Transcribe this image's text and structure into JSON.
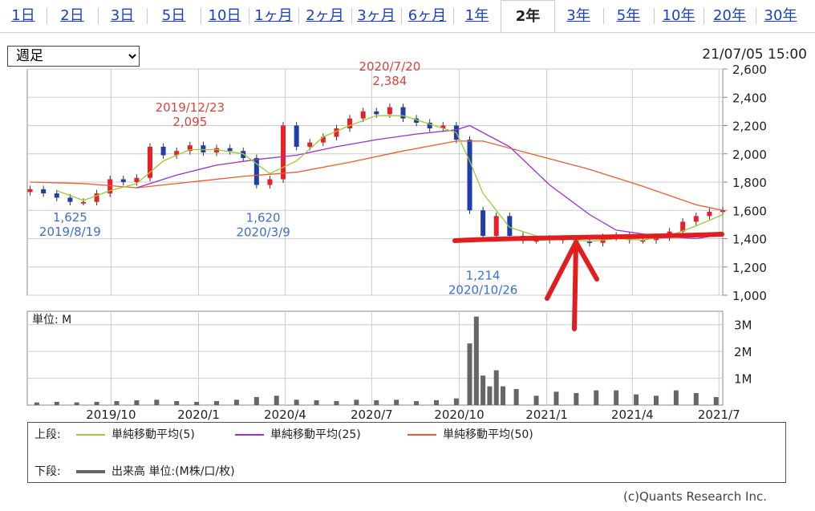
{
  "tabs": [
    "1日",
    "2日",
    "3日",
    "5日",
    "10日",
    "1ヶ月",
    "2ヶ月",
    "3ヶ月",
    "6ヶ月",
    "1年",
    "2年",
    "3年",
    "5年",
    "10年",
    "20年",
    "30年"
  ],
  "active_tab": "2年",
  "period_select": {
    "value": "週足",
    "options": [
      "週足"
    ]
  },
  "timestamp": "21/07/05 15:00",
  "colors": {
    "up": "#e8202a",
    "down": "#1f3ea8",
    "ma5": "#9acd32",
    "ma25": "#9b30d9",
    "ma50": "#ef5b2a",
    "volume": "#666666",
    "annot_high": "#d9443c",
    "annot_low": "#3a6fd8",
    "markup": "#e11d1d"
  },
  "legend": {
    "upper_label": "上段:",
    "lower_label": "下段:",
    "ma5": "単純移動平均(5)",
    "ma25": "単純移動平均(25)",
    "ma50": "単純移動平均(50)",
    "volume": "出来高 単位:(M株/口/枚)"
  },
  "copyright": "(c)Quants Research Inc.",
  "chart_data": [
    {
      "type": "candlestick",
      "ylim": [
        1000,
        2600
      ],
      "y_ticks": [
        "1,000",
        "1,200",
        "1,400",
        "1,600",
        "1,800",
        "2,000",
        "2,200",
        "2,400",
        "2,600"
      ],
      "y_tick_values": [
        1000,
        1200,
        1400,
        1600,
        1800,
        2000,
        2200,
        2400,
        2600
      ],
      "x_range": [
        "2019-07-05",
        "2021-07-05"
      ],
      "x_ticks": [
        {
          "date": "2019-10-01",
          "label": "2019/10"
        },
        {
          "date": "2020-01-01",
          "label": "2020/1"
        },
        {
          "date": "2020-04-01",
          "label": "2020/4"
        },
        {
          "date": "2020-07-01",
          "label": "2020/7"
        },
        {
          "date": "2020-10-01",
          "label": "2020/10"
        },
        {
          "date": "2021-01-01",
          "label": "2021/1"
        },
        {
          "date": "2021-04-01",
          "label": "2021/4"
        },
        {
          "date": "2021-07-01",
          "label": "2021/7"
        }
      ],
      "annotations": [
        {
          "date": "2019-08-19",
          "value": 1625,
          "value_label": "1,625",
          "date_label": "2019/8/19",
          "kind": "low"
        },
        {
          "date": "2019-12-23",
          "value": 2095,
          "value_label": "2,095",
          "date_label": "2019/12/23",
          "kind": "high"
        },
        {
          "date": "2020-03-09",
          "value": 1620,
          "value_label": "1,620",
          "date_label": "2020/3/9",
          "kind": "low"
        },
        {
          "date": "2020-07-20",
          "value": 2384,
          "value_label": "2,384",
          "date_label": "2020/7/20",
          "kind": "high"
        },
        {
          "date": "2020-10-26",
          "value": 1214,
          "value_label": "1,214",
          "date_label": "2020/10/26",
          "kind": "low"
        }
      ],
      "series_close": [
        [
          "2019-07-08",
          1750
        ],
        [
          "2019-07-22",
          1720
        ],
        [
          "2019-08-05",
          1690
        ],
        [
          "2019-08-19",
          1660
        ],
        [
          "2019-09-02",
          1660
        ],
        [
          "2019-09-16",
          1720
        ],
        [
          "2019-09-30",
          1820
        ],
        [
          "2019-10-14",
          1800
        ],
        [
          "2019-10-28",
          1830
        ],
        [
          "2019-11-11",
          2050
        ],
        [
          "2019-11-25",
          1990
        ],
        [
          "2019-12-09",
          2020
        ],
        [
          "2019-12-23",
          2060
        ],
        [
          "2020-01-06",
          2010
        ],
        [
          "2020-01-20",
          2040
        ],
        [
          "2020-02-03",
          2020
        ],
        [
          "2020-02-17",
          1970
        ],
        [
          "2020-03-02",
          1780
        ],
        [
          "2020-03-16",
          1820
        ],
        [
          "2020-03-30",
          2200
        ],
        [
          "2020-04-13",
          2050
        ],
        [
          "2020-04-27",
          2080
        ],
        [
          "2020-05-11",
          2120
        ],
        [
          "2020-05-25",
          2180
        ],
        [
          "2020-06-08",
          2250
        ],
        [
          "2020-06-22",
          2300
        ],
        [
          "2020-07-06",
          2280
        ],
        [
          "2020-07-20",
          2330
        ],
        [
          "2020-08-03",
          2250
        ],
        [
          "2020-08-17",
          2220
        ],
        [
          "2020-08-31",
          2180
        ],
        [
          "2020-09-14",
          2200
        ],
        [
          "2020-09-28",
          2100
        ],
        [
          "2020-10-12",
          1600
        ],
        [
          "2020-10-26",
          1420
        ],
        [
          "2020-11-09",
          1560
        ],
        [
          "2020-11-23",
          1420
        ],
        [
          "2020-12-07",
          1390
        ],
        [
          "2020-12-21",
          1390
        ],
        [
          "2021-01-04",
          1400
        ],
        [
          "2021-01-18",
          1390
        ],
        [
          "2021-02-01",
          1380
        ],
        [
          "2021-02-15",
          1370
        ],
        [
          "2021-03-01",
          1410
        ],
        [
          "2021-03-15",
          1420
        ],
        [
          "2021-03-29",
          1390
        ],
        [
          "2021-04-12",
          1390
        ],
        [
          "2021-04-26",
          1410
        ],
        [
          "2021-05-10",
          1450
        ],
        [
          "2021-05-24",
          1520
        ],
        [
          "2021-06-07",
          1560
        ],
        [
          "2021-06-21",
          1590
        ],
        [
          "2021-07-05",
          1600
        ]
      ],
      "ma5": [
        [
          "2019-08-05",
          1740
        ],
        [
          "2019-09-02",
          1670
        ],
        [
          "2019-09-30",
          1740
        ],
        [
          "2019-10-28",
          1790
        ],
        [
          "2019-11-25",
          1950
        ],
        [
          "2019-12-23",
          2030
        ],
        [
          "2020-01-20",
          2030
        ],
        [
          "2020-02-17",
          2000
        ],
        [
          "2020-03-16",
          1860
        ],
        [
          "2020-04-13",
          1950
        ],
        [
          "2020-05-11",
          2120
        ],
        [
          "2020-06-08",
          2200
        ],
        [
          "2020-07-06",
          2270
        ],
        [
          "2020-08-03",
          2270
        ],
        [
          "2020-08-31",
          2210
        ],
        [
          "2020-09-28",
          2150
        ],
        [
          "2020-10-12",
          1950
        ],
        [
          "2020-10-26",
          1720
        ],
        [
          "2020-11-23",
          1480
        ],
        [
          "2020-12-21",
          1420
        ],
        [
          "2021-01-18",
          1400
        ],
        [
          "2021-02-15",
          1380
        ],
        [
          "2021-03-15",
          1400
        ],
        [
          "2021-04-12",
          1390
        ],
        [
          "2021-05-10",
          1420
        ],
        [
          "2021-06-07",
          1490
        ],
        [
          "2021-07-05",
          1570
        ]
      ],
      "ma25": [
        [
          "2019-10-28",
          1760
        ],
        [
          "2019-12-09",
          1850
        ],
        [
          "2020-01-20",
          1920
        ],
        [
          "2020-03-02",
          1960
        ],
        [
          "2020-04-13",
          1990
        ],
        [
          "2020-05-25",
          2050
        ],
        [
          "2020-07-06",
          2100
        ],
        [
          "2020-08-17",
          2140
        ],
        [
          "2020-09-28",
          2170
        ],
        [
          "2020-10-12",
          2200
        ],
        [
          "2020-11-23",
          2050
        ],
        [
          "2021-01-04",
          1780
        ],
        [
          "2021-02-15",
          1570
        ],
        [
          "2021-03-15",
          1460
        ],
        [
          "2021-04-26",
          1420
        ],
        [
          "2021-06-07",
          1400
        ],
        [
          "2021-07-05",
          1430
        ]
      ],
      "ma50": [
        [
          "2019-07-08",
          1800
        ],
        [
          "2019-09-02",
          1790
        ],
        [
          "2019-10-28",
          1760
        ],
        [
          "2019-12-23",
          1800
        ],
        [
          "2020-02-17",
          1840
        ],
        [
          "2020-04-13",
          1870
        ],
        [
          "2020-06-08",
          1940
        ],
        [
          "2020-08-03",
          2020
        ],
        [
          "2020-09-28",
          2090
        ],
        [
          "2020-10-26",
          2090
        ],
        [
          "2020-12-21",
          1990
        ],
        [
          "2021-02-15",
          1890
        ],
        [
          "2021-04-12",
          1770
        ],
        [
          "2021-06-07",
          1640
        ],
        [
          "2021-07-05",
          1600
        ]
      ]
    },
    {
      "type": "bar",
      "unit_label": "単位: M",
      "ylim": [
        0,
        3.5
      ],
      "y_ticks": [
        "1M",
        "2M",
        "3M"
      ],
      "y_tick_values": [
        1,
        2,
        3
      ],
      "x_range": [
        "2019-07-05",
        "2021-07-05"
      ],
      "x_ticks": [
        {
          "date": "2019-10-01",
          "label": "2019/10"
        },
        {
          "date": "2020-01-01",
          "label": "2020/1"
        },
        {
          "date": "2020-04-01",
          "label": "2020/4"
        },
        {
          "date": "2020-07-01",
          "label": "2020/7"
        },
        {
          "date": "2020-10-01",
          "label": "2020/10"
        },
        {
          "date": "2021-01-01",
          "label": "2021/1"
        },
        {
          "date": "2021-04-01",
          "label": "2021/4"
        },
        {
          "date": "2021-07-01",
          "label": "2021/7"
        }
      ],
      "series": [
        [
          "2019-07-15",
          0.1
        ],
        [
          "2019-08-05",
          0.12
        ],
        [
          "2019-08-26",
          0.1
        ],
        [
          "2019-09-16",
          0.12
        ],
        [
          "2019-10-07",
          0.15
        ],
        [
          "2019-10-28",
          0.18
        ],
        [
          "2019-11-18",
          0.2
        ],
        [
          "2019-12-09",
          0.15
        ],
        [
          "2019-12-30",
          0.12
        ],
        [
          "2020-01-20",
          0.15
        ],
        [
          "2020-02-10",
          0.2
        ],
        [
          "2020-03-02",
          0.3
        ],
        [
          "2020-03-23",
          0.35
        ],
        [
          "2020-04-13",
          0.2
        ],
        [
          "2020-05-04",
          0.18
        ],
        [
          "2020-05-25",
          0.15
        ],
        [
          "2020-06-15",
          0.2
        ],
        [
          "2020-07-06",
          0.18
        ],
        [
          "2020-07-27",
          0.2
        ],
        [
          "2020-08-17",
          0.15
        ],
        [
          "2020-09-07",
          0.18
        ],
        [
          "2020-09-28",
          0.25
        ],
        [
          "2020-10-12",
          2.3
        ],
        [
          "2020-10-19",
          3.3
        ],
        [
          "2020-10-26",
          1.1
        ],
        [
          "2020-11-02",
          0.7
        ],
        [
          "2020-11-09",
          1.3
        ],
        [
          "2020-11-16",
          0.7
        ],
        [
          "2020-11-30",
          0.6
        ],
        [
          "2020-12-21",
          0.35
        ],
        [
          "2021-01-11",
          0.5
        ],
        [
          "2021-02-01",
          0.45
        ],
        [
          "2021-02-22",
          0.55
        ],
        [
          "2021-03-15",
          0.55
        ],
        [
          "2021-04-05",
          0.4
        ],
        [
          "2021-04-26",
          0.35
        ],
        [
          "2021-05-17",
          0.55
        ],
        [
          "2021-06-07",
          0.45
        ],
        [
          "2021-06-28",
          0.3
        ]
      ]
    }
  ]
}
